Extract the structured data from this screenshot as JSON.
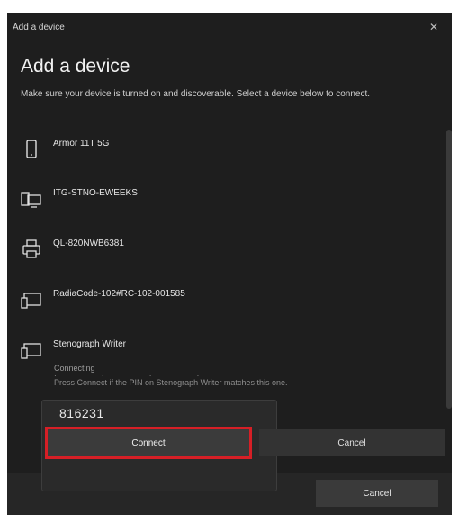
{
  "window": {
    "title": "Add a device",
    "close_symbol": "✕"
  },
  "heading": "Add a device",
  "instructions": "Make sure your device is turned on and discoverable. Select a device below to connect.",
  "devices": [
    {
      "name": "Armor 11T 5G",
      "icon": "phone-icon"
    },
    {
      "name": "ITG-STNO-EWEEKS",
      "icon": "computer-icon"
    },
    {
      "name": "QL-820NWB6381",
      "icon": "printer-icon"
    },
    {
      "name": "RadiaCode-102#RC-102-001585",
      "icon": "bluetooth-device-icon"
    },
    {
      "name": "Stenograph Writer",
      "icon": "bluetooth-device-icon"
    }
  ],
  "connecting": {
    "status": "Connecting",
    "hint": "Press Connect if the PIN on Stenograph Writer matches this one.",
    "pin": "816231",
    "connect_label": "Connect",
    "cancel_label": "Cancel"
  },
  "footer": {
    "cancel_label": "Cancel"
  },
  "colors": {
    "background": "#1e1e1e",
    "highlight": "#d61f26"
  }
}
